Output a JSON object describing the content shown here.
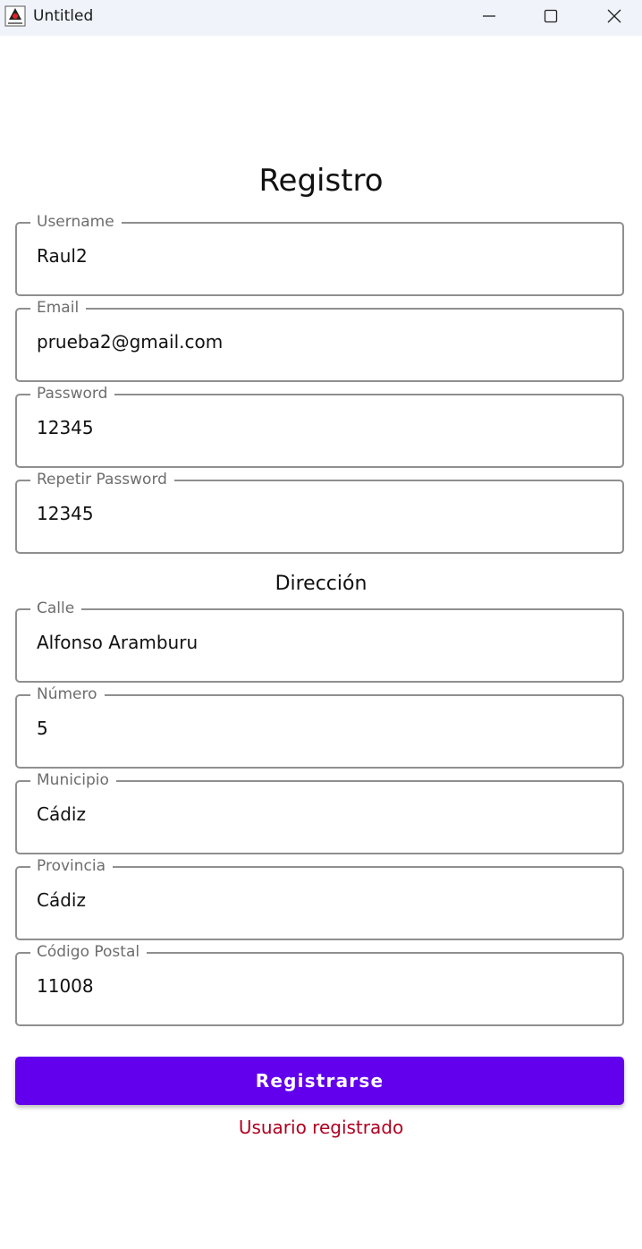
{
  "window": {
    "title": "Untitled",
    "app_icon": "java-duke-icon",
    "controls": [
      "minimize-icon",
      "maximize-icon",
      "close-icon"
    ]
  },
  "form": {
    "title": "Registro",
    "account_fields": [
      {
        "label": "Username",
        "value": "Raul2"
      },
      {
        "label": "Email",
        "value": "prueba2@gmail.com"
      },
      {
        "label": "Password",
        "value": "12345"
      },
      {
        "label": "Repetir Password",
        "value": "12345"
      }
    ],
    "address_title": "Dirección",
    "address_fields": [
      {
        "label": "Calle",
        "value": "Alfonso Aramburu"
      },
      {
        "label": "Número",
        "value": "5"
      },
      {
        "label": "Municipio",
        "value": "Cádiz"
      },
      {
        "label": "Provincia",
        "value": "Cádiz"
      },
      {
        "label": "Código Postal",
        "value": "11008"
      }
    ],
    "submit_label": "Registrarse",
    "status_message": "Usuario registrado"
  },
  "colors": {
    "accent": "#6200ee",
    "error_text": "#b00020",
    "titlebar_bg": "#f0f3f9",
    "field_border": "#8f8f8f"
  }
}
